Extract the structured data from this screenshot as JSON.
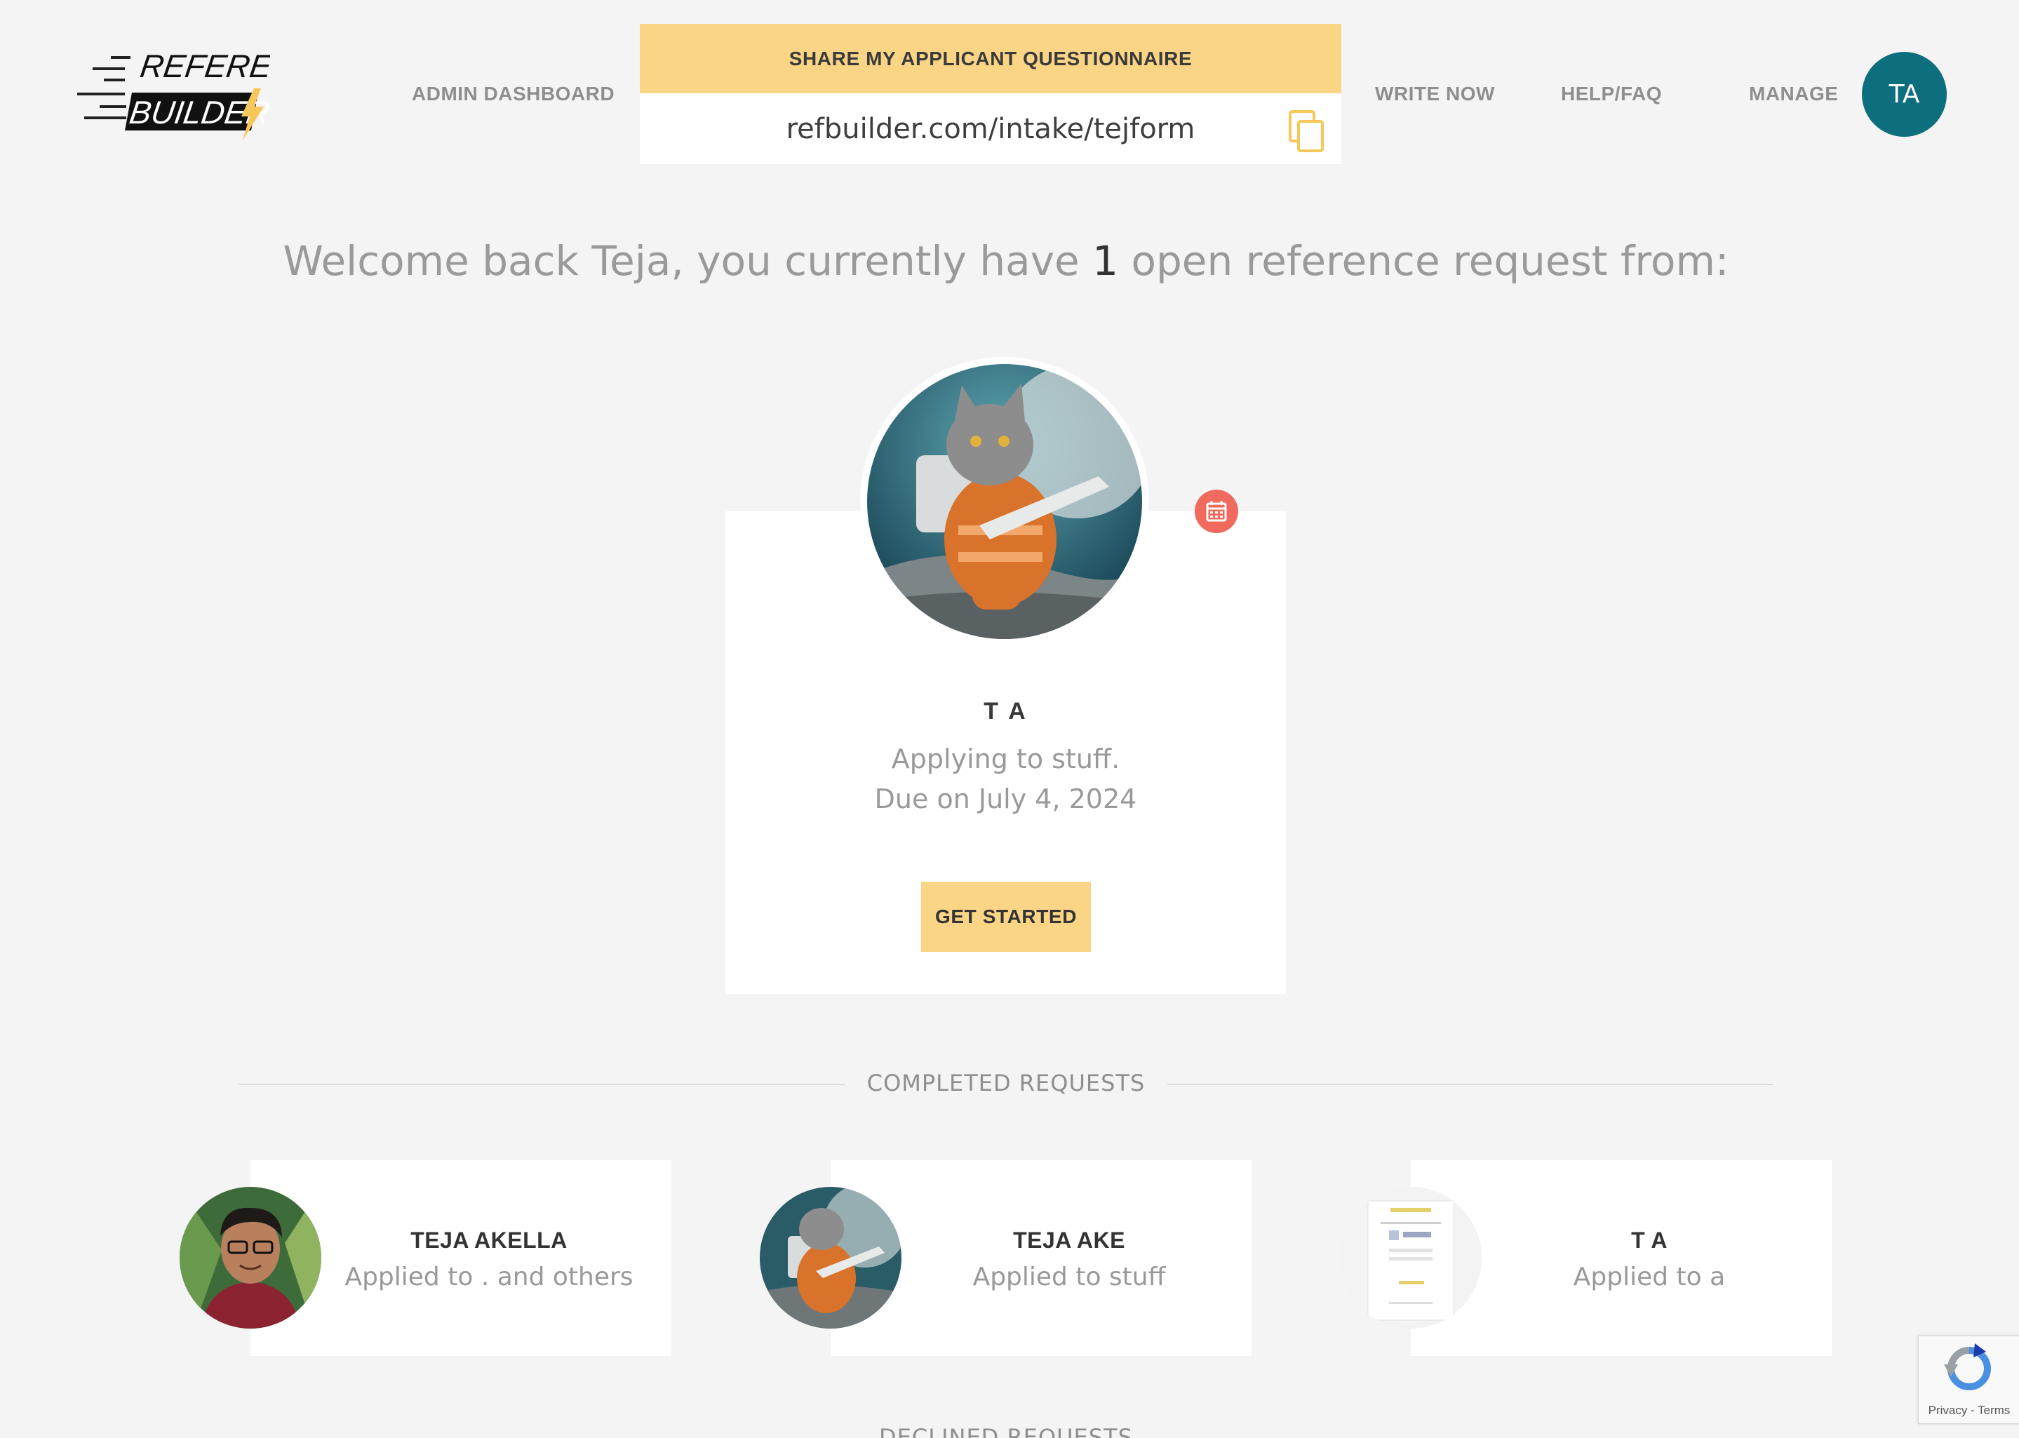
{
  "header": {
    "logo_top": "REFERENCE",
    "logo_bottom": "BUILDER",
    "nav": {
      "admin_dashboard": "ADMIN DASHBOARD",
      "write_now": "WRITE NOW",
      "help_faq": "HELP/FAQ",
      "manage": "MANAGE"
    },
    "share": {
      "title": "SHARE MY APPLICANT QUESTIONNAIRE",
      "url": "refbuilder.com/intake/tejform"
    },
    "avatar_initials": "TA"
  },
  "welcome": {
    "prefix": "Welcome back Teja, you currently have ",
    "count": "1",
    "suffix": " open reference request from:"
  },
  "open_request": {
    "name": "T A",
    "description": "Applying to stuff.",
    "due": "Due on July 4, 2024",
    "button": "GET STARTED"
  },
  "completed": {
    "title": "COMPLETED REQUESTS",
    "items": [
      {
        "name": "TEJA AKELLA",
        "subtitle": "Applied to . and others"
      },
      {
        "name": "TEJA AKE",
        "subtitle": "Applied to stuff"
      },
      {
        "name": "T A",
        "subtitle": "Applied to a"
      }
    ]
  },
  "declined": {
    "title": "DECLINED REQUESTS"
  },
  "recaptcha": {
    "links": "Privacy - Terms"
  },
  "colors": {
    "accent_yellow": "#fad586",
    "avatar_teal": "#0d6e7d",
    "badge_red": "#f06a5d",
    "background": "#f4f4f4"
  },
  "icons": [
    "copy-icon",
    "calendar-icon",
    "recaptcha-icon",
    "lightning-bolt-icon"
  ]
}
